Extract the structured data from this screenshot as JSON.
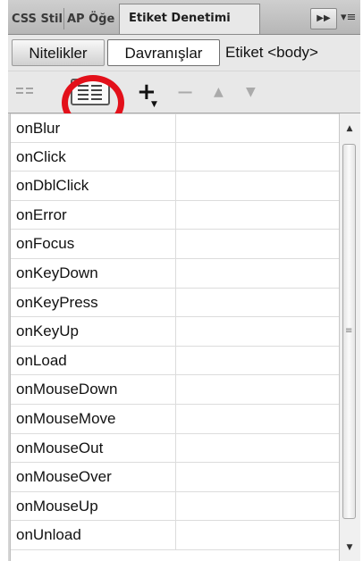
{
  "tabs": [
    {
      "label": "CSS Stilleri",
      "active": false
    },
    {
      "label": "AP Öğeleri",
      "active": false
    },
    {
      "label": "Etiket Denetimi",
      "active": true
    }
  ],
  "tab_collapse_label": "▶▶",
  "tab_menu_label": "▾≡",
  "subtabs": {
    "attributes_label": "Nitelikler",
    "behaviors_label": "Davranışlar",
    "tag_label": "Etiket <body>"
  },
  "toolbar": {
    "category_view_icon": "category-view-icon",
    "list_view_icon": "list-view-icon",
    "add_icon": "add-behavior-icon",
    "remove_icon": "remove-behavior-icon",
    "up_icon": "move-up-icon",
    "down_icon": "move-down-icon",
    "highlight_color": "#e3101a"
  },
  "events": [
    {
      "name": "onBlur",
      "action": ""
    },
    {
      "name": "onClick",
      "action": ""
    },
    {
      "name": "onDblClick",
      "action": ""
    },
    {
      "name": "onError",
      "action": ""
    },
    {
      "name": "onFocus",
      "action": ""
    },
    {
      "name": "onKeyDown",
      "action": ""
    },
    {
      "name": "onKeyPress",
      "action": ""
    },
    {
      "name": "onKeyUp",
      "action": ""
    },
    {
      "name": "onLoad",
      "action": ""
    },
    {
      "name": "onMouseDown",
      "action": ""
    },
    {
      "name": "onMouseMove",
      "action": ""
    },
    {
      "name": "onMouseOut",
      "action": ""
    },
    {
      "name": "onMouseOver",
      "action": ""
    },
    {
      "name": "onMouseUp",
      "action": ""
    },
    {
      "name": "onUnload",
      "action": ""
    }
  ]
}
